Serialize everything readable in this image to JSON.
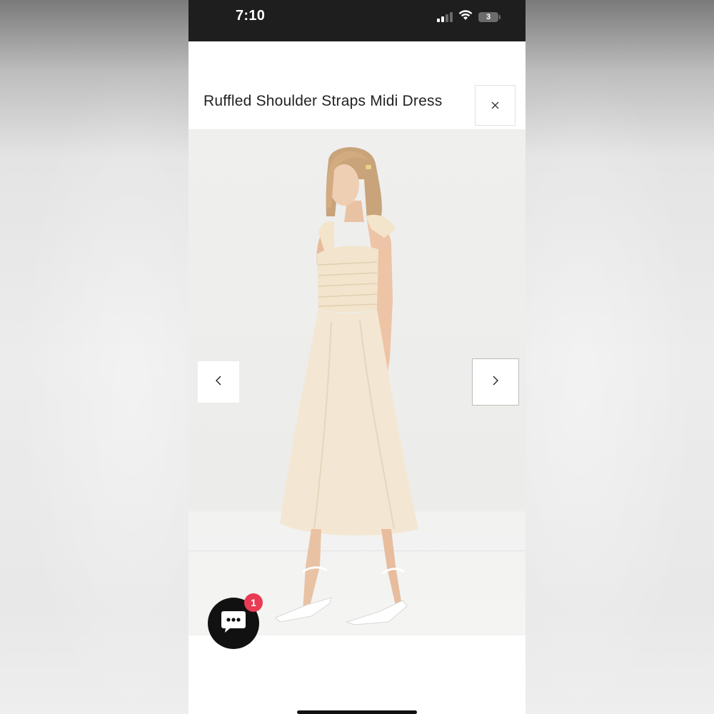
{
  "status_bar": {
    "time": "7:10",
    "battery_level": "3",
    "icons": [
      "signal-icon",
      "wifi-icon",
      "battery-icon"
    ]
  },
  "product": {
    "title": "Ruffled Shoulder Straps Midi Dress"
  },
  "gallery": {
    "image_alt": "model-wearing-cream-midi-dress",
    "prev_icon": "chevron-left-icon",
    "next_icon": "chevron-right-icon"
  },
  "chat": {
    "icon": "chat-bubble-icon",
    "badge_count": "1"
  },
  "colors": {
    "status_bar_bg": "#1e1e1e",
    "chat_launcher_bg": "#111111",
    "badge_bg": "#e93b53",
    "dress": "#f3e7d3"
  }
}
